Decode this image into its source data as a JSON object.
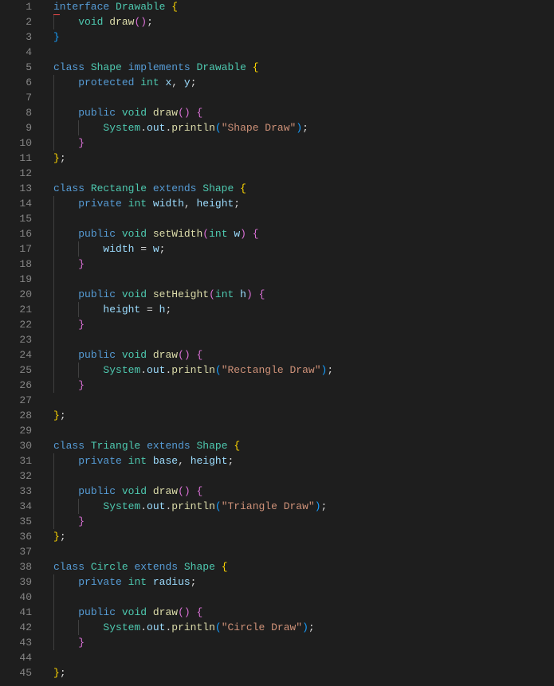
{
  "editor": {
    "language": "java",
    "lines": [
      [
        [
          "k",
          "interface"
        ],
        [
          "p",
          " "
        ],
        [
          "t",
          "Drawable"
        ],
        [
          "p",
          " "
        ],
        [
          "b1",
          "{"
        ]
      ],
      [
        [
          "p",
          "    "
        ],
        [
          "t",
          "void"
        ],
        [
          "p",
          " "
        ],
        [
          "f",
          "draw"
        ],
        [
          "b2",
          "()"
        ],
        [
          "p",
          ";"
        ]
      ],
      [
        [
          "b3",
          "}"
        ]
      ],
      [],
      [
        [
          "k",
          "class"
        ],
        [
          "p",
          " "
        ],
        [
          "t",
          "Shape"
        ],
        [
          "p",
          " "
        ],
        [
          "k",
          "implements"
        ],
        [
          "p",
          " "
        ],
        [
          "t",
          "Drawable"
        ],
        [
          "p",
          " "
        ],
        [
          "b1",
          "{"
        ]
      ],
      [
        [
          "p",
          "    "
        ],
        [
          "k",
          "protected"
        ],
        [
          "p",
          " "
        ],
        [
          "t",
          "int"
        ],
        [
          "p",
          " "
        ],
        [
          "v",
          "x"
        ],
        [
          "p",
          ", "
        ],
        [
          "v",
          "y"
        ],
        [
          "p",
          ";"
        ]
      ],
      [],
      [
        [
          "p",
          "    "
        ],
        [
          "k",
          "public"
        ],
        [
          "p",
          " "
        ],
        [
          "t",
          "void"
        ],
        [
          "p",
          " "
        ],
        [
          "f",
          "draw"
        ],
        [
          "b2",
          "()"
        ],
        [
          "p",
          " "
        ],
        [
          "b2",
          "{"
        ]
      ],
      [
        [
          "p",
          "        "
        ],
        [
          "t",
          "System"
        ],
        [
          "p",
          "."
        ],
        [
          "v",
          "out"
        ],
        [
          "p",
          "."
        ],
        [
          "f",
          "println"
        ],
        [
          "b3",
          "("
        ],
        [
          "s",
          "\"Shape Draw\""
        ],
        [
          "b3",
          ")"
        ],
        [
          "p",
          ";"
        ]
      ],
      [
        [
          "p",
          "    "
        ],
        [
          "b2",
          "}"
        ]
      ],
      [
        [
          "b1",
          "}"
        ],
        [
          "p",
          ";"
        ]
      ],
      [],
      [
        [
          "k",
          "class"
        ],
        [
          "p",
          " "
        ],
        [
          "t",
          "Rectangle"
        ],
        [
          "p",
          " "
        ],
        [
          "k",
          "extends"
        ],
        [
          "p",
          " "
        ],
        [
          "t",
          "Shape"
        ],
        [
          "p",
          " "
        ],
        [
          "b1",
          "{"
        ]
      ],
      [
        [
          "p",
          "    "
        ],
        [
          "k",
          "private"
        ],
        [
          "p",
          " "
        ],
        [
          "t",
          "int"
        ],
        [
          "p",
          " "
        ],
        [
          "v",
          "width"
        ],
        [
          "p",
          ", "
        ],
        [
          "v",
          "height"
        ],
        [
          "p",
          ";"
        ]
      ],
      [],
      [
        [
          "p",
          "    "
        ],
        [
          "k",
          "public"
        ],
        [
          "p",
          " "
        ],
        [
          "t",
          "void"
        ],
        [
          "p",
          " "
        ],
        [
          "f",
          "setWidth"
        ],
        [
          "b2",
          "("
        ],
        [
          "t",
          "int"
        ],
        [
          "p",
          " "
        ],
        [
          "v",
          "w"
        ],
        [
          "b2",
          ")"
        ],
        [
          "p",
          " "
        ],
        [
          "b2",
          "{"
        ]
      ],
      [
        [
          "p",
          "        "
        ],
        [
          "v",
          "width"
        ],
        [
          "p",
          " = "
        ],
        [
          "v",
          "w"
        ],
        [
          "p",
          ";"
        ]
      ],
      [
        [
          "p",
          "    "
        ],
        [
          "b2",
          "}"
        ]
      ],
      [],
      [
        [
          "p",
          "    "
        ],
        [
          "k",
          "public"
        ],
        [
          "p",
          " "
        ],
        [
          "t",
          "void"
        ],
        [
          "p",
          " "
        ],
        [
          "f",
          "setHeight"
        ],
        [
          "b2",
          "("
        ],
        [
          "t",
          "int"
        ],
        [
          "p",
          " "
        ],
        [
          "v",
          "h"
        ],
        [
          "b2",
          ")"
        ],
        [
          "p",
          " "
        ],
        [
          "b2",
          "{"
        ]
      ],
      [
        [
          "p",
          "        "
        ],
        [
          "v",
          "height"
        ],
        [
          "p",
          " = "
        ],
        [
          "v",
          "h"
        ],
        [
          "p",
          ";"
        ]
      ],
      [
        [
          "p",
          "    "
        ],
        [
          "b2",
          "}"
        ]
      ],
      [],
      [
        [
          "p",
          "    "
        ],
        [
          "k",
          "public"
        ],
        [
          "p",
          " "
        ],
        [
          "t",
          "void"
        ],
        [
          "p",
          " "
        ],
        [
          "f",
          "draw"
        ],
        [
          "b2",
          "()"
        ],
        [
          "p",
          " "
        ],
        [
          "b2",
          "{"
        ]
      ],
      [
        [
          "p",
          "        "
        ],
        [
          "t",
          "System"
        ],
        [
          "p",
          "."
        ],
        [
          "v",
          "out"
        ],
        [
          "p",
          "."
        ],
        [
          "f",
          "println"
        ],
        [
          "b3",
          "("
        ],
        [
          "s",
          "\"Rectangle Draw\""
        ],
        [
          "b3",
          ")"
        ],
        [
          "p",
          ";"
        ]
      ],
      [
        [
          "p",
          "    "
        ],
        [
          "b2",
          "}"
        ]
      ],
      [],
      [
        [
          "b1",
          "}"
        ],
        [
          "p",
          ";"
        ]
      ],
      [],
      [
        [
          "k",
          "class"
        ],
        [
          "p",
          " "
        ],
        [
          "t",
          "Triangle"
        ],
        [
          "p",
          " "
        ],
        [
          "k",
          "extends"
        ],
        [
          "p",
          " "
        ],
        [
          "t",
          "Shape"
        ],
        [
          "p",
          " "
        ],
        [
          "b1",
          "{"
        ]
      ],
      [
        [
          "p",
          "    "
        ],
        [
          "k",
          "private"
        ],
        [
          "p",
          " "
        ],
        [
          "t",
          "int"
        ],
        [
          "p",
          " "
        ],
        [
          "v",
          "base"
        ],
        [
          "p",
          ", "
        ],
        [
          "v",
          "height"
        ],
        [
          "p",
          ";"
        ]
      ],
      [],
      [
        [
          "p",
          "    "
        ],
        [
          "k",
          "public"
        ],
        [
          "p",
          " "
        ],
        [
          "t",
          "void"
        ],
        [
          "p",
          " "
        ],
        [
          "f",
          "draw"
        ],
        [
          "b2",
          "()"
        ],
        [
          "p",
          " "
        ],
        [
          "b2",
          "{"
        ]
      ],
      [
        [
          "p",
          "        "
        ],
        [
          "t",
          "System"
        ],
        [
          "p",
          "."
        ],
        [
          "v",
          "out"
        ],
        [
          "p",
          "."
        ],
        [
          "f",
          "println"
        ],
        [
          "b3",
          "("
        ],
        [
          "s",
          "\"Triangle Draw\""
        ],
        [
          "b3",
          ")"
        ],
        [
          "p",
          ";"
        ]
      ],
      [
        [
          "p",
          "    "
        ],
        [
          "b2",
          "}"
        ]
      ],
      [
        [
          "b1",
          "}"
        ],
        [
          "p",
          ";"
        ]
      ],
      [],
      [
        [
          "k",
          "class"
        ],
        [
          "p",
          " "
        ],
        [
          "t",
          "Circle"
        ],
        [
          "p",
          " "
        ],
        [
          "k",
          "extends"
        ],
        [
          "p",
          " "
        ],
        [
          "t",
          "Shape"
        ],
        [
          "p",
          " "
        ],
        [
          "b1",
          "{"
        ]
      ],
      [
        [
          "p",
          "    "
        ],
        [
          "k",
          "private"
        ],
        [
          "p",
          " "
        ],
        [
          "t",
          "int"
        ],
        [
          "p",
          " "
        ],
        [
          "v",
          "radius"
        ],
        [
          "p",
          ";"
        ]
      ],
      [],
      [
        [
          "p",
          "    "
        ],
        [
          "k",
          "public"
        ],
        [
          "p",
          " "
        ],
        [
          "t",
          "void"
        ],
        [
          "p",
          " "
        ],
        [
          "f",
          "draw"
        ],
        [
          "b2",
          "()"
        ],
        [
          "p",
          " "
        ],
        [
          "b2",
          "{"
        ]
      ],
      [
        [
          "p",
          "        "
        ],
        [
          "t",
          "System"
        ],
        [
          "p",
          "."
        ],
        [
          "v",
          "out"
        ],
        [
          "p",
          "."
        ],
        [
          "f",
          "println"
        ],
        [
          "b3",
          "("
        ],
        [
          "s",
          "\"Circle Draw\""
        ],
        [
          "b3",
          ")"
        ],
        [
          "p",
          ";"
        ]
      ],
      [
        [
          "p",
          "    "
        ],
        [
          "b2",
          "}"
        ]
      ],
      [],
      [
        [
          "b1",
          "}"
        ],
        [
          "p",
          ";"
        ]
      ]
    ]
  }
}
